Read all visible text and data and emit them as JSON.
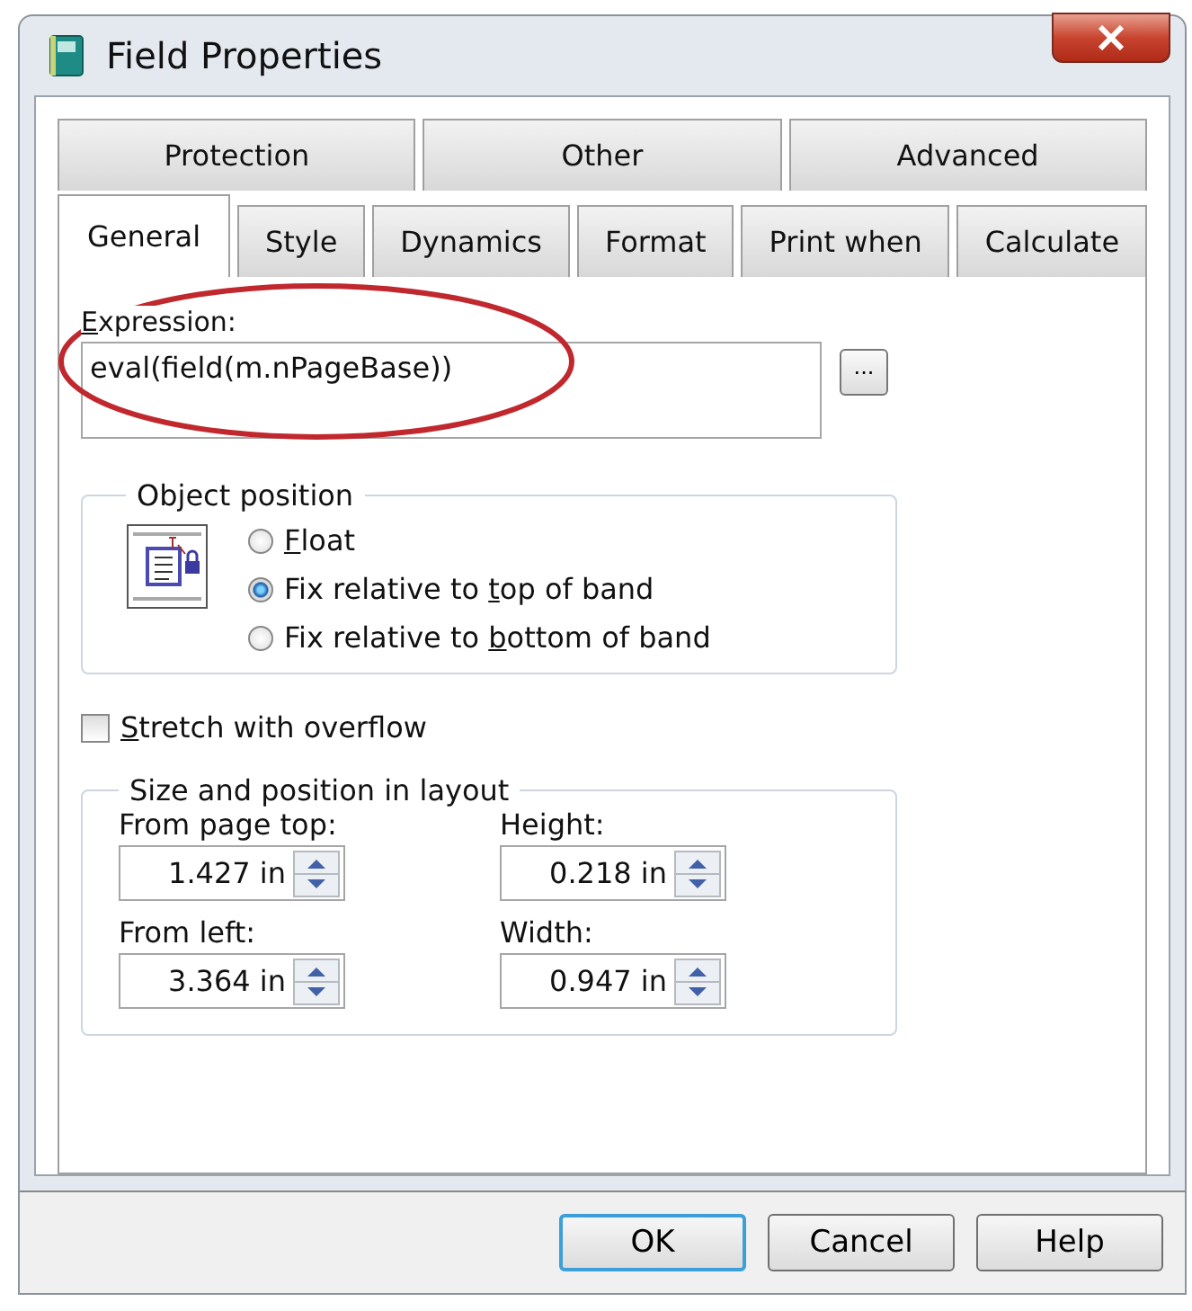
{
  "window": {
    "title": "Field Properties"
  },
  "tab_rows": [
    {
      "tabs": [
        {
          "label": "Protection",
          "selected": false
        },
        {
          "label": "Other",
          "selected": false
        },
        {
          "label": "Advanced",
          "selected": false
        }
      ]
    },
    {
      "tabs": [
        {
          "label": "General",
          "selected": true
        },
        {
          "label": "Style",
          "selected": false
        },
        {
          "label": "Dynamics",
          "selected": false
        },
        {
          "label": "Format",
          "selected": false
        },
        {
          "label": "Print when",
          "selected": false
        },
        {
          "label": "Calculate",
          "selected": false
        }
      ]
    }
  ],
  "expression": {
    "label": {
      "key": "E",
      "after": "xpression:"
    },
    "value": "eval(field(m.nPageBase))",
    "button": "...",
    "circled": true
  },
  "object_position": {
    "title": "Object position",
    "options": [
      {
        "label": {
          "key": "F",
          "after": "loat"
        },
        "selected": false
      },
      {
        "label": {
          "before": "Fix relative to ",
          "key": "t",
          "after": "op of band"
        },
        "selected": true
      },
      {
        "label": {
          "before": "Fix relative to ",
          "key": "b",
          "after": "ottom of band"
        },
        "selected": false
      }
    ]
  },
  "stretch": {
    "label": {
      "key": "S",
      "after": "tretch with overflow"
    },
    "checked": false
  },
  "size_position": {
    "title": "Size and position in layout",
    "fields": [
      {
        "label": "From page top:",
        "value": "1.427 in"
      },
      {
        "label": "Height:",
        "value": "0.218 in"
      },
      {
        "label": "From left:",
        "value": "3.364 in"
      },
      {
        "label": "Width:",
        "value": "0.947 in"
      }
    ]
  },
  "buttons": [
    {
      "label": "OK",
      "default": true
    },
    {
      "label": "Cancel",
      "default": false
    },
    {
      "label": "Help",
      "default": false
    }
  ]
}
